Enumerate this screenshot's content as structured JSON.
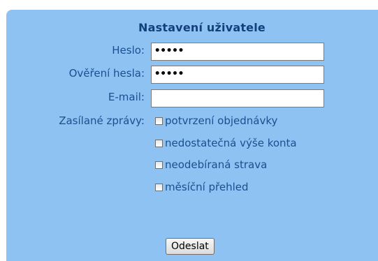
{
  "form": {
    "title": "Nastavení uživatele",
    "fields": [
      {
        "label": "Heslo:",
        "value": "•••••",
        "type": "password"
      },
      {
        "label": "Ověření hesla:",
        "value": "•••••",
        "type": "password"
      },
      {
        "label": "E-mail:",
        "value": "",
        "type": "text"
      }
    ],
    "messages_label": "Zasílané zprávy:",
    "messages": [
      {
        "label": "potvrzení objednávky",
        "checked": false
      },
      {
        "label": "nedostatečná výše konta",
        "checked": false
      },
      {
        "label": "neodebíraná strava",
        "checked": false
      },
      {
        "label": "měsíční přehled",
        "checked": false
      }
    ],
    "submit_label": "Odeslat"
  },
  "colors": {
    "panel": "#8ec2f2",
    "title": "#13407a",
    "label": "#1c4f90"
  }
}
